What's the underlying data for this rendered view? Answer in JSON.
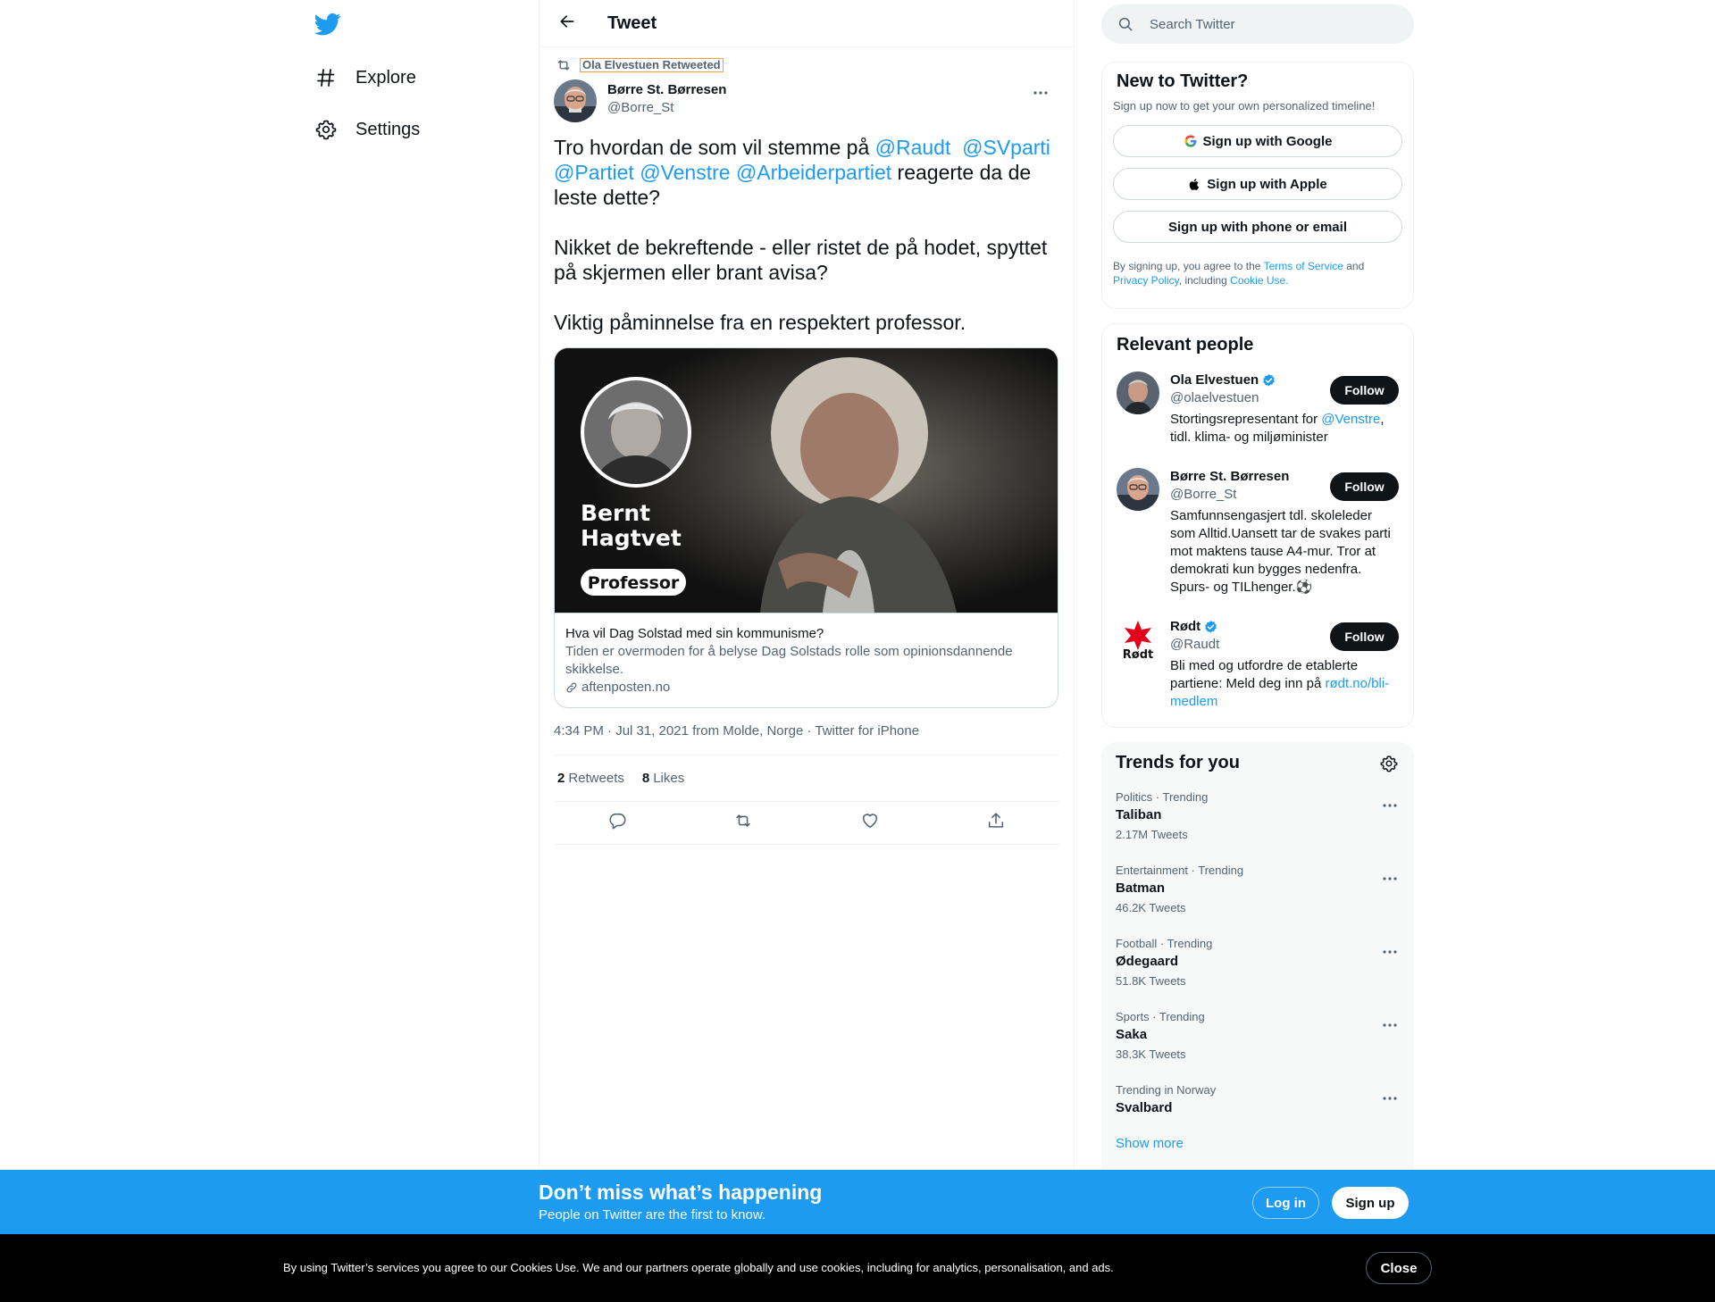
{
  "nav": {
    "items": [
      {
        "label": "Explore",
        "icon": "hashtag-icon"
      },
      {
        "label": "Settings",
        "icon": "gear-icon"
      }
    ]
  },
  "header": {
    "title": "Tweet"
  },
  "tweet": {
    "retweeted_by": "Ola Elvestuen Retweeted",
    "author_name": "Børre St. Børresen",
    "author_handle": "@Borre_St",
    "text": {
      "p1_a": "Tro hvordan de som vil stemme på ",
      "m1": "@Raudt",
      "m2": "@SVparti",
      "m3": "@Partiet",
      "m4": "@Venstre",
      "m5": "@Arbeiderpartiet",
      "p1_b": " reagerte da de leste dette?",
      "p2": "Nikket de bekreftende - eller ristet de på hodet, spyttet på skjermen eller brant avisa?",
      "p3": "Viktig påminnelse fra en respektert professor."
    },
    "card": {
      "overlay_name_line1": "Bernt",
      "overlay_name_line2": "Hagtvet",
      "overlay_role": "Professor",
      "title": "Hva vil Dag Solstad med sin kommunisme?",
      "description": "Tiden er overmoden for å belyse Dag Solstads rolle som opinionsdannende skikkelse.",
      "domain": "aftenposten.no"
    },
    "timestamp": "4:34 PM · Jul 31, 2021 from Molde, Norge · Twitter for iPhone",
    "retweets_count": "2",
    "retweets_label": "Retweets",
    "likes_count": "8",
    "likes_label": "Likes"
  },
  "search": {
    "placeholder": "Search Twitter"
  },
  "new_to_twitter": {
    "title": "New to Twitter?",
    "subtitle": "Sign up now to get your own personalized timeline!",
    "google": "Sign up with Google",
    "apple": "Sign up with Apple",
    "phone": "Sign up with phone or email",
    "legal_a": "By signing up, you agree to the ",
    "terms": "Terms of Service",
    "legal_b": " and ",
    "privacy": "Privacy Policy",
    "legal_c": ", including ",
    "cookie": "Cookie Use."
  },
  "relevant_people": {
    "title": "Relevant people",
    "follow_label": "Follow",
    "people": [
      {
        "name": "Ola Elvestuen",
        "handle": "@olaelvestuen",
        "verified": true,
        "bio_a": "Stortingsrepresentant for ",
        "bio_link": "@Venstre",
        "bio_b": ", tidl. klima- og miljøminister"
      },
      {
        "name": "Børre St. Børresen",
        "handle": "@Borre_St",
        "verified": false,
        "bio_a": "Samfunnsengasjert tdl. skoleleder som Alltid.Uansett tar de svakes parti mot maktens tause A4-mur. Tror at demokrati kun bygges nedenfra. Spurs- og TILhenger.⚽",
        "bio_link": "",
        "bio_b": ""
      },
      {
        "name": "Rødt",
        "handle": "@Raudt",
        "verified": true,
        "logo_text": "Rødt",
        "bio_a": "Bli med og utfordre de etablerte partiene: Meld deg inn på ",
        "bio_link": "rødt.no/bli-medlem",
        "bio_b": ""
      }
    ]
  },
  "trends": {
    "title": "Trends for you",
    "items": [
      {
        "category": "Politics · Trending",
        "name": "Taliban",
        "count": "2.17M Tweets"
      },
      {
        "category": "Entertainment · Trending",
        "name": "Batman",
        "count": "46.2K Tweets"
      },
      {
        "category": "Football · Trending",
        "name": "Ødegaard",
        "count": "51.8K Tweets"
      },
      {
        "category": "Sports · Trending",
        "name": "Saka",
        "count": "38.3K Tweets"
      },
      {
        "category": "Trending in Norway",
        "name": "Svalbard",
        "count": ""
      }
    ],
    "show_more": "Show more"
  },
  "banner": {
    "title": "Don’t miss what’s happening",
    "subtitle": "People on Twitter are the first to know.",
    "login": "Log in",
    "signup": "Sign up"
  },
  "cookies": {
    "text": "By using Twitter’s services you agree to our Cookies Use. We and our partners operate globally and use cookies, including for analytics, personalisation, and ads.",
    "close": "Close"
  },
  "colors": {
    "accent": "#1d9bf0",
    "text": "#0f1419",
    "secondary": "#536471",
    "border": "#eff3f4",
    "cookie_bar": "#000000",
    "rodt_red": "#e3001b"
  }
}
